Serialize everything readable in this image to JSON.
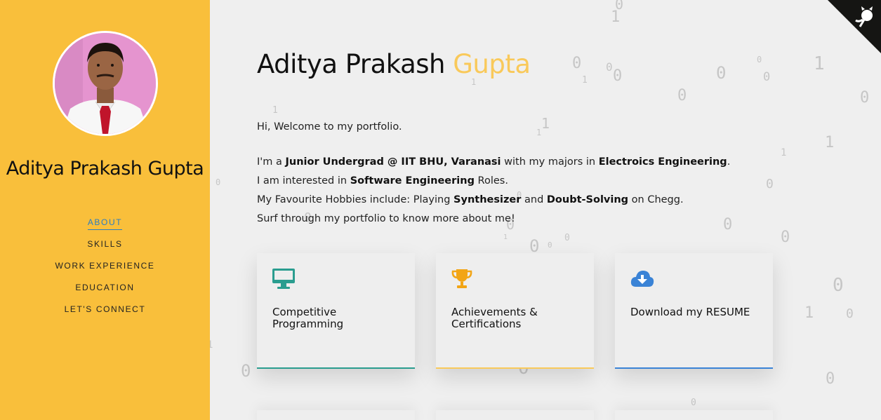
{
  "sidebar": {
    "name": "Aditya Prakash Gupta",
    "nav": [
      "ABOUT",
      "SKILLS",
      "WORK EXPERIENCE",
      "EDUCATION",
      "LET'S CONNECT"
    ]
  },
  "header": {
    "title_first": "Aditya Prakash",
    "title_accent": "Gupta"
  },
  "intro": {
    "welcome": "Hi, Welcome to my portfolio.",
    "line1": [
      "I'm a ",
      "Junior Undergrad @ IIT BHU, Varanasi",
      " with my majors in ",
      "Electroics Engineering",
      "."
    ],
    "line2": [
      "I am interested in ",
      "Software Engineering",
      " Roles."
    ],
    "line3": [
      "My Favourite Hobbies include: Playing ",
      "Synthesizer",
      " and ",
      "Doubt-Solving",
      " on Chegg."
    ],
    "line4": "Surf through my portfolio to know more about me!"
  },
  "cards": [
    {
      "label": "Competitive Programming",
      "icon": "monitor-icon",
      "accent": "#2a9d8f"
    },
    {
      "label": "Achievements & Certifications",
      "icon": "trophy-icon",
      "accent": "#f9c95a"
    },
    {
      "label": "Download my RESUME",
      "icon": "cloud-download-icon",
      "accent": "#3a83d6"
    }
  ],
  "colors": {
    "sidebar_bg": "#f9bf3b",
    "accent_yellow": "#f9c95a",
    "link_blue": "#2c7dc0"
  }
}
